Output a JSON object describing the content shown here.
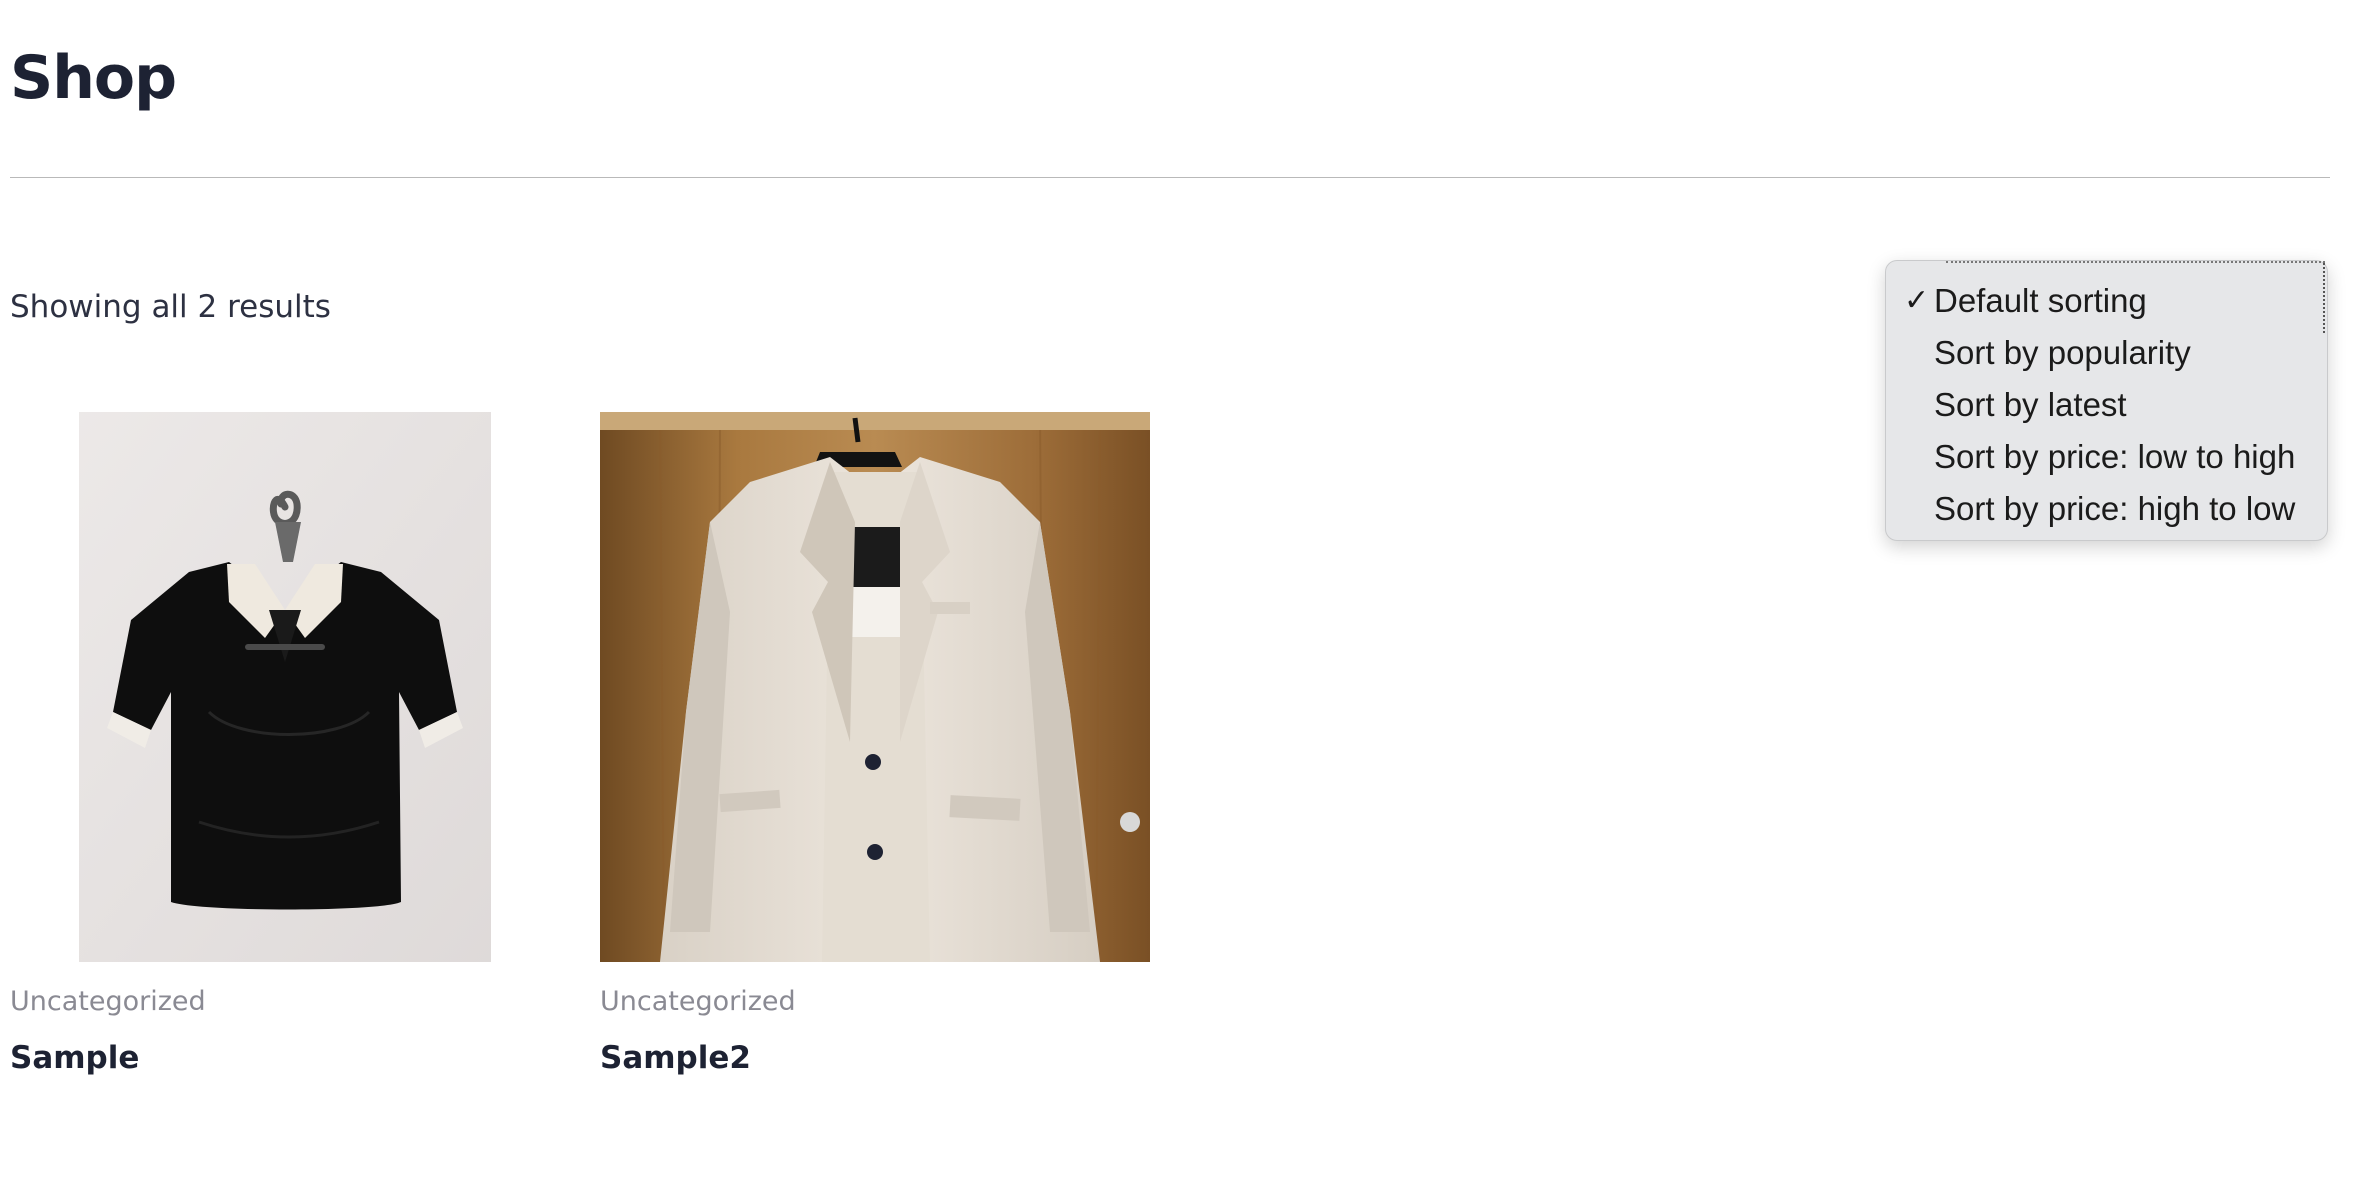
{
  "page": {
    "title": "Shop",
    "result_count": "Showing all 2 results"
  },
  "sorting": {
    "check_glyph": "✓",
    "options": [
      {
        "label": "Default sorting",
        "selected": true
      },
      {
        "label": "Sort by popularity",
        "selected": false
      },
      {
        "label": "Sort by latest",
        "selected": false
      },
      {
        "label": "Sort by price: low to high",
        "selected": false
      },
      {
        "label": "Sort by price: high to low",
        "selected": false
      }
    ]
  },
  "products": [
    {
      "category": "Uncategorized",
      "name": "Sample",
      "image": "black-shirt-white-collar-on-hanger"
    },
    {
      "category": "Uncategorized",
      "name": "Sample2",
      "image": "cream-blazer-on-hanger"
    }
  ],
  "colors": {
    "title": "#1d2233",
    "muted": "#8a8a93",
    "dropdown_bg": "#e6e7e9"
  }
}
